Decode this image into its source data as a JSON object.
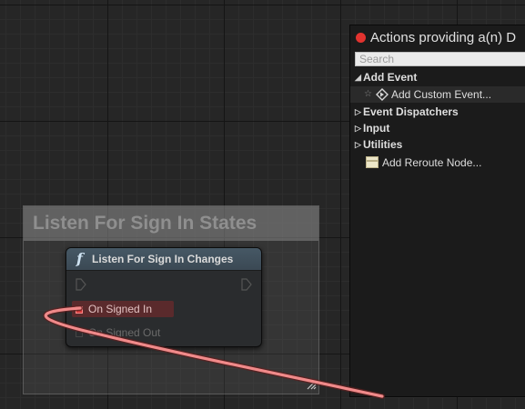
{
  "comment": {
    "title": "Listen For Sign In States"
  },
  "node": {
    "icon": "function-icon",
    "icon_glyph": "f",
    "title": "Listen For Sign In Changes",
    "pins": [
      {
        "label": "On Signed In",
        "color": "#d23a3a"
      },
      {
        "label": "On Signed Out",
        "color": "#454545"
      }
    ]
  },
  "wire": {
    "color": "#f08a8a"
  },
  "menu": {
    "title": "Actions providing a(n) D",
    "search_placeholder": "Search",
    "items": [
      {
        "label": "Add Event",
        "type": "category",
        "expanded": true
      },
      {
        "label": "Add Custom Event...",
        "type": "action",
        "icon": "custom-event-icon",
        "favorite_icon": "star-icon"
      },
      {
        "label": "Event Dispatchers",
        "type": "category",
        "expanded": false
      },
      {
        "label": "Input",
        "type": "category",
        "expanded": false
      },
      {
        "label": "Utilities",
        "type": "category",
        "expanded": false
      },
      {
        "label": "Add Reroute Node...",
        "type": "action",
        "icon": "reroute-node-icon"
      }
    ]
  }
}
